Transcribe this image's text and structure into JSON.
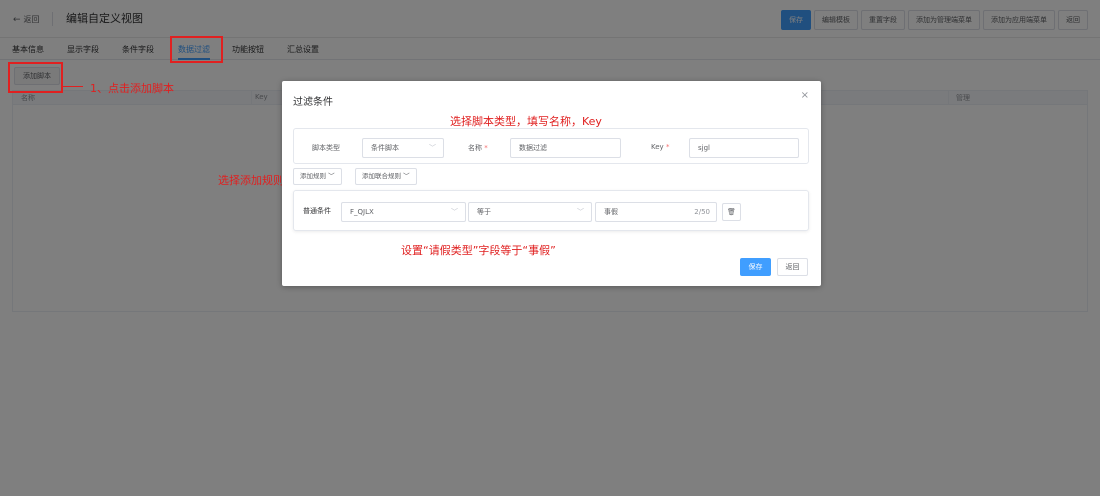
{
  "header": {
    "back_label": "返回",
    "back_arrow": "←",
    "title": "编辑自定义视图",
    "actions": [
      "保存",
      "编辑模板",
      "重置字段",
      "添加为管理端菜单",
      "添加为应用端菜单",
      "返回"
    ]
  },
  "tabs": [
    "基本信息",
    "显示字段",
    "条件字段",
    "数据过滤",
    "功能按钮",
    "汇总设置"
  ],
  "active_tab": "数据过滤",
  "main": {
    "add_script_label": "添加脚本",
    "columns": [
      "名称",
      "Key",
      "管理"
    ]
  },
  "annotations": {
    "step1": "1、点击添加脚本",
    "select_type": "选择脚本类型，填写名称，Key",
    "select_rule": "选择添加规则",
    "set_condition": "设置“请假类型”字段等于“事假”",
    "color": "#e02020"
  },
  "dialog": {
    "title": "过滤条件",
    "close_glyph": "×",
    "script_type_label": "脚本类型",
    "script_type_value": "条件脚本",
    "name_label": "名称",
    "name_value": "数据过滤",
    "key_label": "Key",
    "key_value": "sjgl",
    "required_mark": "*",
    "add_rule_label": "添加规则",
    "add_union_rule_label": "添加联合规则",
    "rule": {
      "label": "普通条件",
      "field": "F_QJLX",
      "operator": "等于",
      "value": "事假",
      "char_count": "2/50",
      "delete_glyph": "🗑"
    },
    "save_label": "保存",
    "back_label": "返回"
  },
  "colors": {
    "primary": "#409eff",
    "overlay": "rgba(0,0,0,0.5)"
  }
}
